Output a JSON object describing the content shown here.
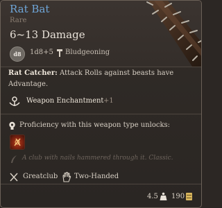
{
  "item": {
    "name": "Rat Bat",
    "rarity": "Rare",
    "damage": "6~13 Damage",
    "dice": "1d8+5",
    "damage_type": "Bludgeoning",
    "passive": {
      "name": "Rat Catcher:",
      "description": "Attack Rolls against beasts have Advantage."
    },
    "enchantment": {
      "name": "Weapon Enchantment",
      "value": "+1"
    },
    "proficiency_text": "Proficiency with this weapon type unlocks:",
    "flavor_text": "A club with nails hammered through it. Classic.",
    "tags": [
      "Greatclub",
      "Two-Handed"
    ],
    "weight": "4.5",
    "price": "190"
  },
  "colors": {
    "rarity_title": "#6fa6d8",
    "background": "#2f2a26",
    "text": "#d8d0c5",
    "muted": "#8a7e72",
    "coin": "#d8b65e"
  },
  "icons": {
    "dice": "d8-die-badge",
    "damage_type": "hammer-icon",
    "enchantment": "rune-icon",
    "proficiency": "bulb-icon",
    "action": "weapon-action-icon",
    "flavor": "quill-icon",
    "weapon_type": "crossed-swords-icon",
    "hands": "hand-icon",
    "weight": "weight-icon",
    "price": "coin-icon"
  }
}
